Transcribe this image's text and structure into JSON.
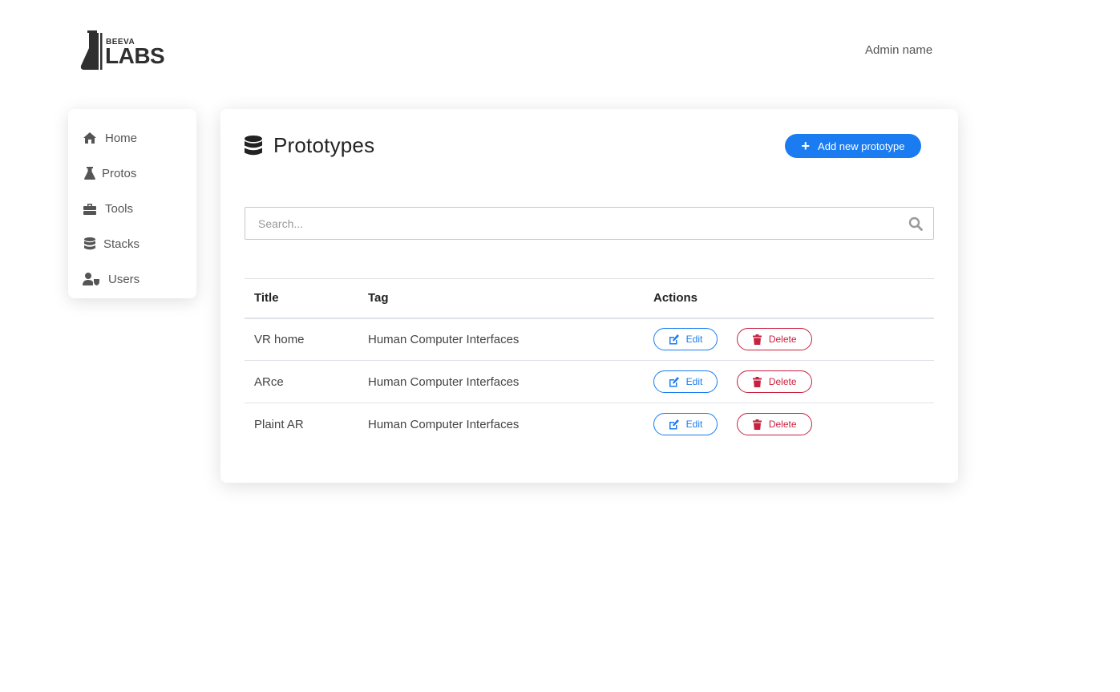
{
  "brand": {
    "top": "BEEVA",
    "main": "LABS"
  },
  "header": {
    "user": "Admin name"
  },
  "sidebar": {
    "items": [
      {
        "label": "Home",
        "icon": "home-icon"
      },
      {
        "label": "Protos",
        "icon": "flask-icon"
      },
      {
        "label": "Tools",
        "icon": "toolbox-icon"
      },
      {
        "label": "Stacks",
        "icon": "database-icon"
      },
      {
        "label": "Users",
        "icon": "user-shield-icon"
      }
    ]
  },
  "main": {
    "title": "Prototypes",
    "add_button": "Add new prototype",
    "search_placeholder": "Search...",
    "columns": [
      "Title",
      "Tag",
      "Actions"
    ],
    "rows": [
      {
        "title": "VR home",
        "tag": "Human Computer Interfaces"
      },
      {
        "title": "ARce",
        "tag": "Human Computer Interfaces"
      },
      {
        "title": "Plaint AR",
        "tag": "Human Computer Interfaces"
      }
    ],
    "edit_label": "Edit",
    "delete_label": "Delete"
  },
  "colors": {
    "primary": "#1a7cf0",
    "danger": "#c8203f",
    "text": "#333333"
  }
}
